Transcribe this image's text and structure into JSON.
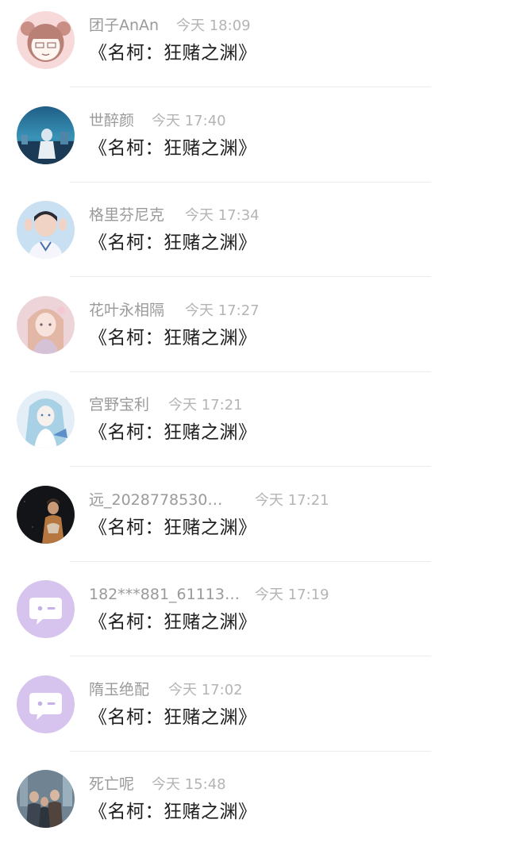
{
  "comments": [
    {
      "name": "团子AnAn",
      "time": "今天 18:09",
      "text": "《名柯：狂赌之渊》",
      "avatar": "cartoon-girl-avatar"
    },
    {
      "name": "世醉颜",
      "time": "今天 17:40",
      "text": "《名柯：狂赌之渊》",
      "avatar": "anime-scene-avatar"
    },
    {
      "name": "格里芬尼克",
      "time": "今天 17:34",
      "text": "《名柯：狂赌之渊》",
      "avatar": "person-photo-avatar"
    },
    {
      "name": "花叶永相隔",
      "time": "今天 17:27",
      "text": "《名柯：狂赌之渊》",
      "avatar": "anime-girl-avatar"
    },
    {
      "name": "宫野宝利",
      "time": "今天 17:21",
      "text": "《名柯：狂赌之渊》",
      "avatar": "blue-anime-avatar"
    },
    {
      "name": "远_2028778530…",
      "time": "今天 17:21",
      "text": "《名柯：狂赌之渊》",
      "avatar": "dark-photo-avatar"
    },
    {
      "name": "182***881_61113…",
      "time": "今天 17:19",
      "text": "《名柯：狂赌之渊》",
      "avatar": "default-chat-avatar"
    },
    {
      "name": "隋玉绝配",
      "time": "今天 17:02",
      "text": "《名柯：狂赌之渊》",
      "avatar": "default-chat-avatar"
    },
    {
      "name": "死亡呢",
      "time": "今天 15:48",
      "text": "《名柯：狂赌之渊》",
      "avatar": "group-photo-avatar"
    }
  ]
}
